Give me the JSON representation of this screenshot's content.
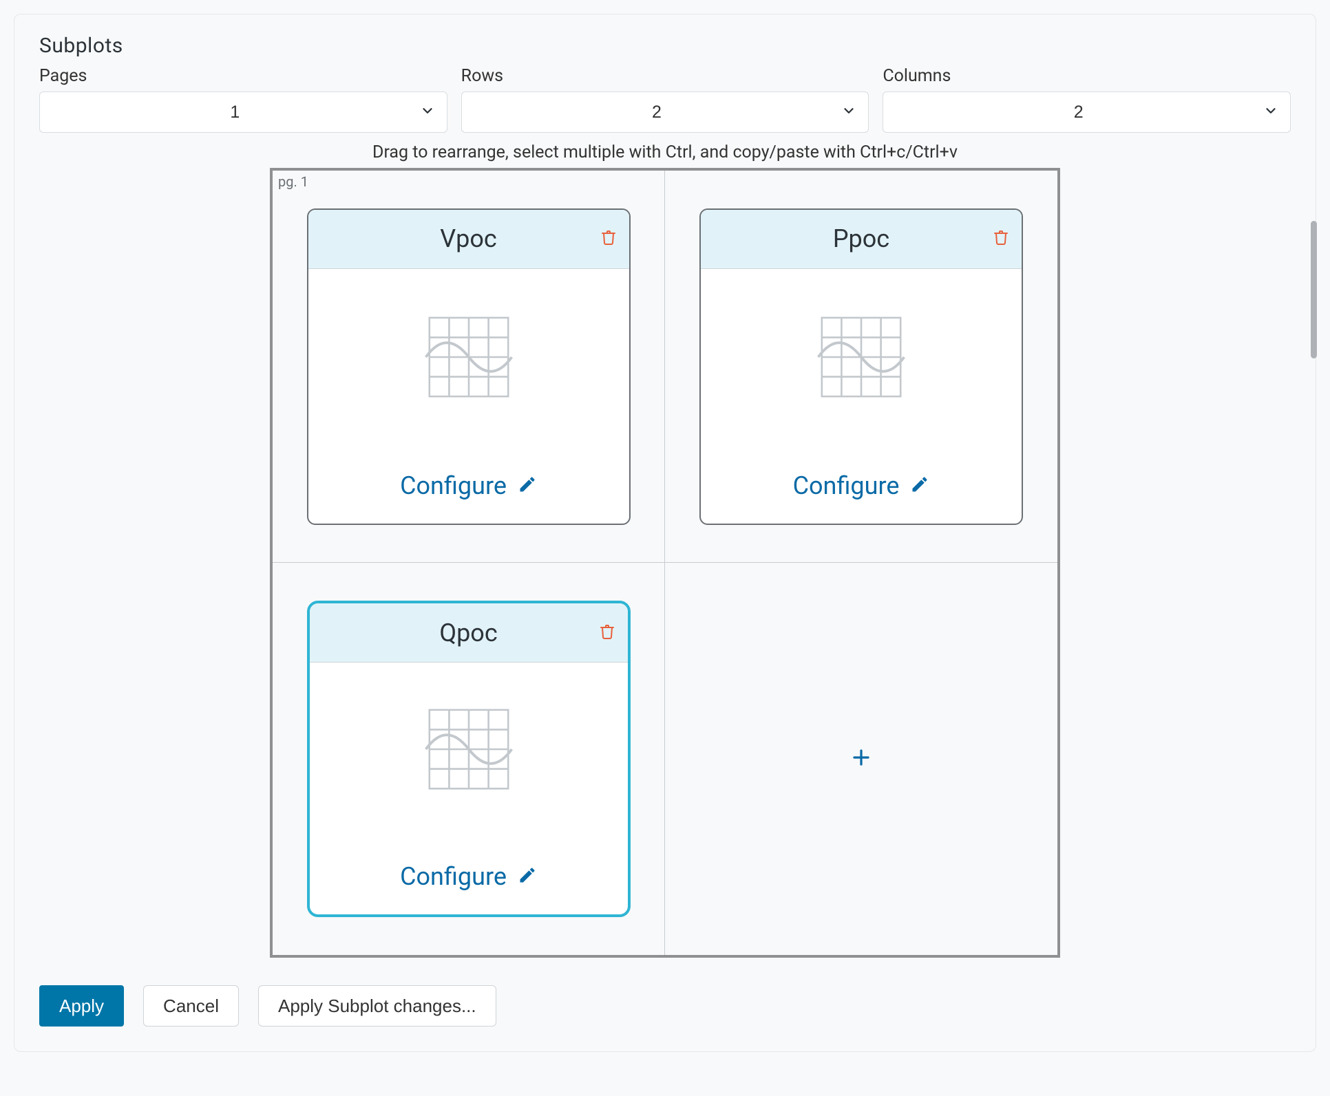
{
  "panel": {
    "title": "Subplots",
    "hint": "Drag to rearrange, select multiple with Ctrl, and copy/paste with Ctrl+c/Ctrl+v"
  },
  "controls": {
    "pages": {
      "label": "Pages",
      "value": "1"
    },
    "rows": {
      "label": "Rows",
      "value": "2"
    },
    "columns": {
      "label": "Columns",
      "value": "2"
    }
  },
  "gridPage": {
    "label": "pg. 1"
  },
  "cards": [
    {
      "title": "Vpoc",
      "configure": "Configure",
      "selected": false
    },
    {
      "title": "Ppoc",
      "configure": "Configure",
      "selected": false
    },
    {
      "title": "Qpoc",
      "configure": "Configure",
      "selected": true
    }
  ],
  "buttons": {
    "apply": "Apply",
    "cancel": "Cancel",
    "applySubplot": "Apply Subplot changes..."
  }
}
